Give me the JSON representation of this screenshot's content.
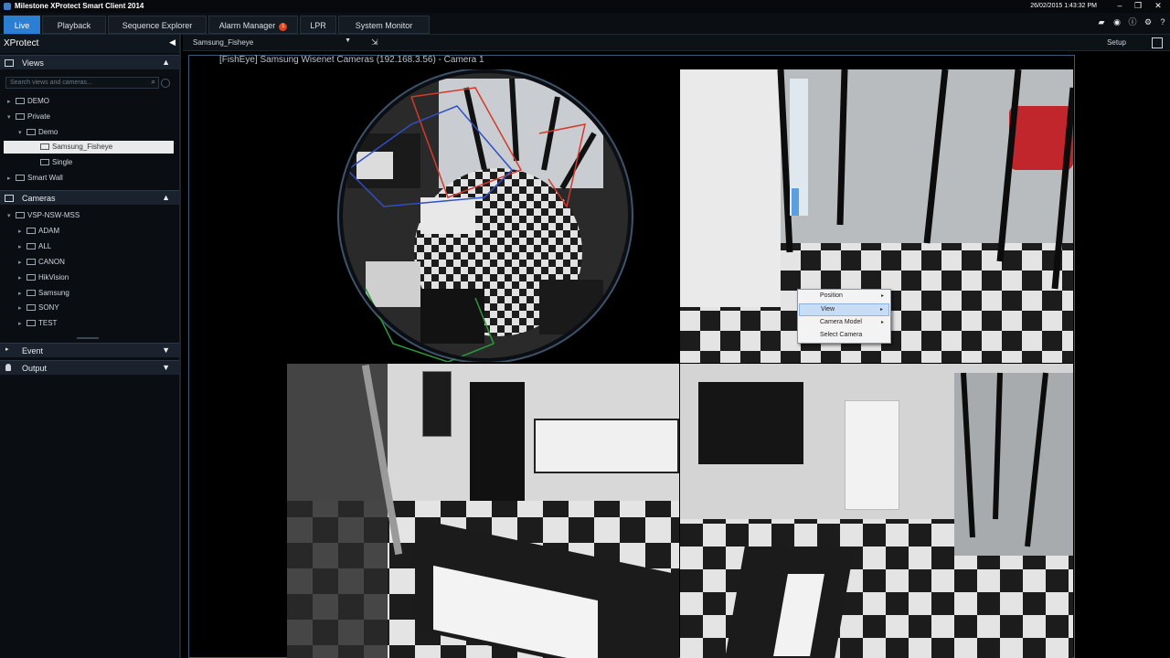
{
  "window": {
    "title": "Milestone XProtect Smart Client 2014",
    "datetime": "26/02/2015 1:43:32 PM"
  },
  "tabs": [
    {
      "label": "Live",
      "active": true
    },
    {
      "label": "Playback"
    },
    {
      "label": "Sequence Explorer"
    },
    {
      "label": "Alarm Manager",
      "badge": "1"
    },
    {
      "label": "LPR"
    },
    {
      "label": "System Monitor"
    }
  ],
  "sidebar": {
    "title": "XProtect",
    "views": {
      "header": "Views",
      "search_placeholder": "Search views and cameras...",
      "items": [
        {
          "label": "DEMO",
          "indent": 0,
          "expand": "collapsed"
        },
        {
          "label": "Private",
          "indent": 0,
          "expand": "expanded"
        },
        {
          "label": "Demo",
          "indent": 1,
          "expand": "expanded"
        },
        {
          "label": "Samsung_Fisheye",
          "indent": 2,
          "selected": true
        },
        {
          "label": "Single",
          "indent": 2
        },
        {
          "label": "Smart Wall",
          "indent": 0,
          "expand": "collapsed"
        }
      ]
    },
    "cameras": {
      "header": "Cameras",
      "items": [
        {
          "label": "VSP-NSW-MSS",
          "indent": 0,
          "expand": "expanded"
        },
        {
          "label": "ADAM",
          "indent": 1,
          "expand": "collapsed"
        },
        {
          "label": "ALL",
          "indent": 1,
          "expand": "collapsed"
        },
        {
          "label": "CANON",
          "indent": 1,
          "expand": "collapsed"
        },
        {
          "label": "HikVision",
          "indent": 1,
          "expand": "collapsed"
        },
        {
          "label": "Samsung",
          "indent": 1,
          "expand": "collapsed"
        },
        {
          "label": "SONY",
          "indent": 1,
          "expand": "collapsed"
        },
        {
          "label": "TEST",
          "indent": 1,
          "expand": "collapsed"
        }
      ]
    },
    "event": {
      "header": "Event"
    },
    "output": {
      "header": "Output"
    }
  },
  "toolbar": {
    "view_name": "Samsung_Fisheye",
    "setup_label": "Setup"
  },
  "camera_view": {
    "title": "[FishEye] Samsung Wisenet Cameras (192.168.3.56) - Camera 1"
  },
  "context_menu": {
    "items": [
      {
        "label": "Position",
        "has_submenu": true
      },
      {
        "label": "View",
        "has_submenu": true,
        "hovered": true
      },
      {
        "label": "Camera Model",
        "has_submenu": true
      },
      {
        "label": "Select Camera",
        "has_submenu": false
      }
    ]
  },
  "colors": {
    "accent": "#2a7fd4",
    "alarm": "#e0451f",
    "ptz_red": "#d33a2c",
    "ptz_blue": "#2f4fc4",
    "ptz_green": "#2c9a3c"
  }
}
